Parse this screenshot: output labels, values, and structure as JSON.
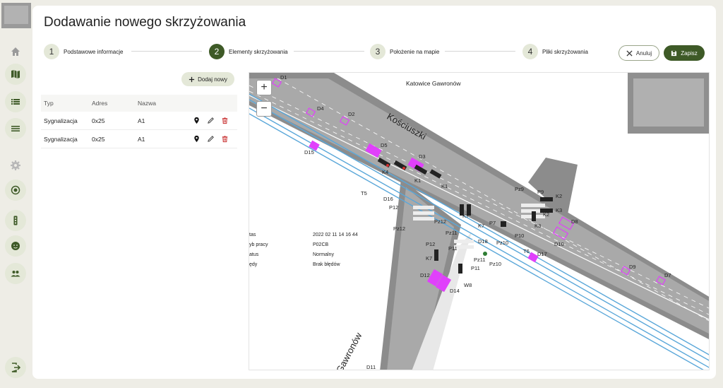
{
  "page": {
    "title": "Dodawanie nowego skrzyżowania"
  },
  "sidebar": {
    "items": [
      {
        "name": "home",
        "icon": "home-icon"
      },
      {
        "name": "map",
        "icon": "map-icon"
      },
      {
        "name": "list",
        "icon": "list-icon"
      },
      {
        "name": "menu",
        "icon": "menu-icon"
      },
      {
        "name": "settings",
        "icon": "gear-icon"
      },
      {
        "name": "target",
        "icon": "target-icon"
      },
      {
        "name": "traffic-light",
        "icon": "traffic-light-icon"
      },
      {
        "name": "face",
        "icon": "face-icon"
      },
      {
        "name": "users",
        "icon": "users-icon"
      },
      {
        "name": "logout",
        "icon": "logout-icon"
      }
    ]
  },
  "stepper": {
    "steps": [
      {
        "num": "1",
        "label": "Podstawowe informacje"
      },
      {
        "num": "2",
        "label": "Elementy skrzyżowania"
      },
      {
        "num": "3",
        "label": "Położenie na mapie"
      },
      {
        "num": "4",
        "label": "Pliki skrzyżowania"
      }
    ],
    "active": 1
  },
  "actions": {
    "cancel_label": "Anuluj",
    "save_label": "Zapisz"
  },
  "elements": {
    "add_label": "Dodaj nowy",
    "columns": [
      "Typ",
      "Adres",
      "Nazwa"
    ],
    "rows": [
      {
        "type": "Sygnalizacja",
        "address": "0x25",
        "name": "A1"
      },
      {
        "type": "Sygnalizacja",
        "address": "0x25",
        "name": "A1"
      }
    ]
  },
  "map": {
    "zoom_in": "+",
    "zoom_out": "−",
    "header": "Katowice   Gawronów",
    "streets": {
      "main": "Kościuszki",
      "side": "Gawronów"
    },
    "status": [
      {
        "key": "tas",
        "value": "2022 02 11 14 16 44"
      },
      {
        "key": "yb pracy",
        "value": "P02CB"
      },
      {
        "key": "atus",
        "value": "Normalny"
      },
      {
        "key": "ędy",
        "value": "Brak błędów"
      }
    ],
    "labels": [
      "D1",
      "D4",
      "D2",
      "D15",
      "D5",
      "D3",
      "K4",
      "K1",
      "K1",
      "T5",
      "D16",
      "P12",
      "Pz12",
      "Pz12",
      "P12",
      "Pz11",
      "P11",
      "K7",
      "K7",
      "K7",
      "P7",
      "D18",
      "P10",
      "Pz10",
      "T6",
      "D17",
      "Pz9",
      "P9",
      "K2",
      "K2",
      "K3",
      "K3",
      "D8",
      "D10",
      "D9",
      "D7",
      "D12",
      "D14",
      "W8",
      "Pz11",
      "P11",
      "Pz10",
      "D11"
    ]
  },
  "colors": {
    "primary": "#3e5a27",
    "accent_light": "#e4e8d8",
    "danger": "#c62828",
    "detector": "#e040fb"
  }
}
